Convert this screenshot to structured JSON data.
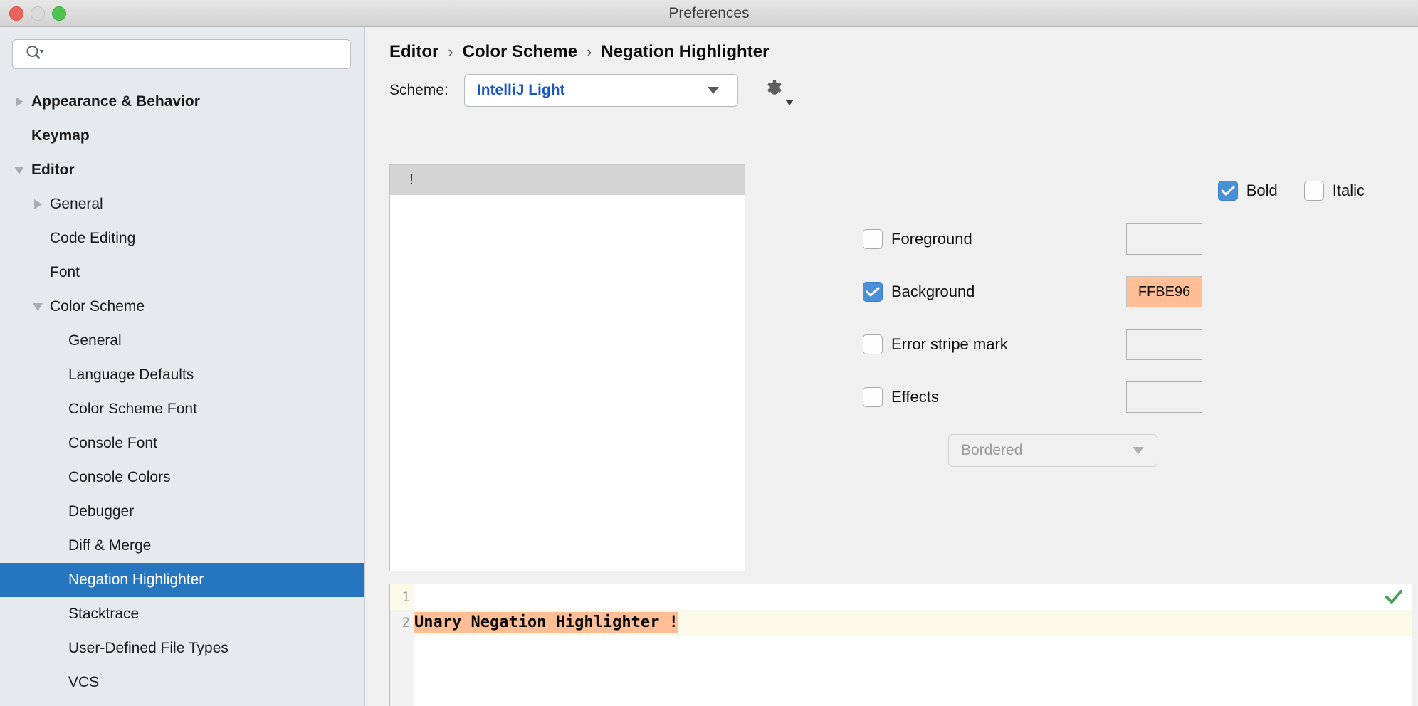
{
  "window": {
    "title": "Preferences",
    "traffic_lights": [
      "close-button",
      "minimize-button",
      "zoom-button"
    ]
  },
  "sidebar": {
    "search": {
      "value": "",
      "placeholder": "",
      "icon": "search-icon"
    },
    "items": [
      {
        "label": "Appearance & Behavior",
        "level": 0,
        "twisty": "right",
        "selected": false
      },
      {
        "label": "Keymap",
        "level": 0,
        "twisty": "none",
        "selected": false
      },
      {
        "label": "Editor",
        "level": 0,
        "twisty": "down",
        "selected": false
      },
      {
        "label": "General",
        "level": 1,
        "twisty": "right",
        "selected": false
      },
      {
        "label": "Code Editing",
        "level": 1,
        "twisty": "none",
        "selected": false
      },
      {
        "label": "Font",
        "level": 1,
        "twisty": "none",
        "selected": false
      },
      {
        "label": "Color Scheme",
        "level": 1,
        "twisty": "down",
        "selected": false
      },
      {
        "label": "General",
        "level": 2,
        "twisty": "none",
        "selected": false
      },
      {
        "label": "Language Defaults",
        "level": 2,
        "twisty": "none",
        "selected": false
      },
      {
        "label": "Color Scheme Font",
        "level": 2,
        "twisty": "none",
        "selected": false
      },
      {
        "label": "Console Font",
        "level": 2,
        "twisty": "none",
        "selected": false
      },
      {
        "label": "Console Colors",
        "level": 2,
        "twisty": "none",
        "selected": false
      },
      {
        "label": "Debugger",
        "level": 2,
        "twisty": "none",
        "selected": false
      },
      {
        "label": "Diff & Merge",
        "level": 2,
        "twisty": "none",
        "selected": false
      },
      {
        "label": "Negation Highlighter",
        "level": 2,
        "twisty": "none",
        "selected": true
      },
      {
        "label": "Stacktrace",
        "level": 2,
        "twisty": "none",
        "selected": false
      },
      {
        "label": "User-Defined File Types",
        "level": 2,
        "twisty": "none",
        "selected": false
      },
      {
        "label": "VCS",
        "level": 2,
        "twisty": "none",
        "selected": false
      }
    ]
  },
  "breadcrumb": {
    "items": [
      "Editor",
      "Color Scheme",
      "Negation Highlighter"
    ],
    "separator": "›"
  },
  "scheme": {
    "label": "Scheme:",
    "value": "IntelliJ Light",
    "gear_icon": "gear-icon",
    "dropdown_icon": "chevron-down-icon"
  },
  "attributes": {
    "items": [
      {
        "label": "!",
        "selected": true
      }
    ]
  },
  "options": {
    "bold": {
      "label": "Bold",
      "checked": true
    },
    "italic": {
      "label": "Italic",
      "checked": false
    },
    "rows": [
      {
        "label": "Foreground",
        "checked": false,
        "swatch": "",
        "filled": false
      },
      {
        "label": "Background",
        "checked": true,
        "swatch": "FFBE96",
        "filled": true
      },
      {
        "label": "Error stripe mark",
        "checked": false,
        "swatch": "",
        "filled": false
      },
      {
        "label": "Effects",
        "checked": false,
        "swatch": "",
        "filled": false
      }
    ],
    "effect_select": {
      "value": "Bordered",
      "enabled": false
    }
  },
  "preview": {
    "lines": [
      {
        "number": "1",
        "text": "Unary Negation Highlighter !",
        "highlighted": true
      },
      {
        "number": "2",
        "text": "",
        "highlighted": false
      }
    ],
    "status_icon": "green-check-icon"
  },
  "colors": {
    "accent": "#2675bf",
    "checkbox_on": "#4a90d9",
    "scheme_value": "#1a56c4",
    "background_swatch": "#FFBE96",
    "caret_row": "#fbfae9",
    "status_ok": "#4a9e5c"
  }
}
